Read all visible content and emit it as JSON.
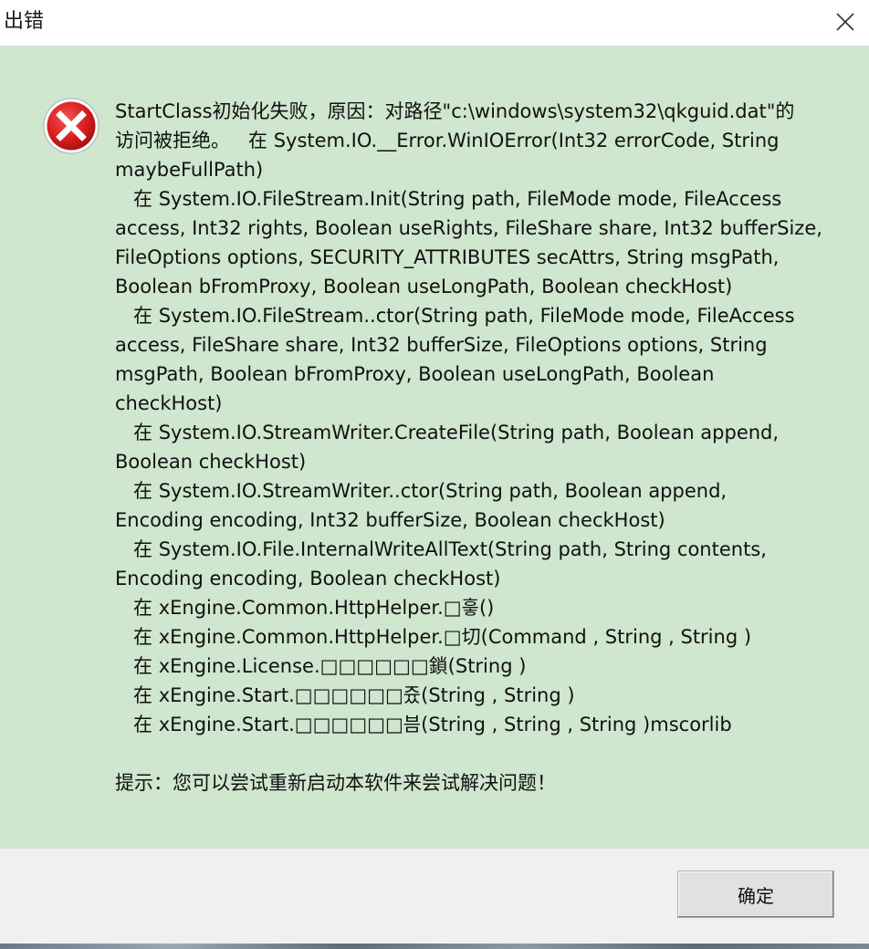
{
  "window": {
    "title": "出错",
    "close_icon": "close-icon"
  },
  "content": {
    "icon": "error-icon",
    "message_lines": [
      "StartClass初始化失败，原因：对路径\"c:\\windows\\system32\\qkguid.dat\"的",
      "访问被拒绝。   在 System.IO.__Error.WinIOError(Int32 errorCode, String",
      "maybeFullPath)",
      "   在 System.IO.FileStream.Init(String path, FileMode mode, FileAccess",
      "access, Int32 rights, Boolean useRights, FileShare share, Int32 bufferSize,",
      "FileOptions options, SECURITY_ATTRIBUTES secAttrs, String msgPath,",
      "Boolean bFromProxy, Boolean useLongPath, Boolean checkHost)",
      "   在 System.IO.FileStream..ctor(String path, FileMode mode, FileAccess",
      "access, FileShare share, Int32 bufferSize, FileOptions options, String",
      "msgPath, Boolean bFromProxy, Boolean useLongPath, Boolean",
      "checkHost)",
      "   在 System.IO.StreamWriter.CreateFile(String path, Boolean append,",
      "Boolean checkHost)",
      "   在 System.IO.StreamWriter..ctor(String path, Boolean append,",
      "Encoding encoding, Int32 bufferSize, Boolean checkHost)",
      "   在 System.IO.File.InternalWriteAllText(String path, String contents,",
      "Encoding encoding, Boolean checkHost)",
      "   在 xEngine.Common.HttpHelper.□흫()",
      "   在 xEngine.Common.HttpHelper.□切(Command , String , String )",
      "   在 xEngine.License.□□□□□□鎖(String )",
      "   在 xEngine.Start.□□□□□□즀(String , String )",
      "   在 xEngine.Start.□□□□□□븜(String , String , String )mscorlib"
    ],
    "hint": "提示：您可以尝试重新启动本软件来尝试解决问题！"
  },
  "footer": {
    "ok_label": "确定"
  },
  "colors": {
    "content_bg": "#cfe6cf",
    "footer_bg": "#f0f0f0",
    "error_red": "#d81e1e"
  }
}
